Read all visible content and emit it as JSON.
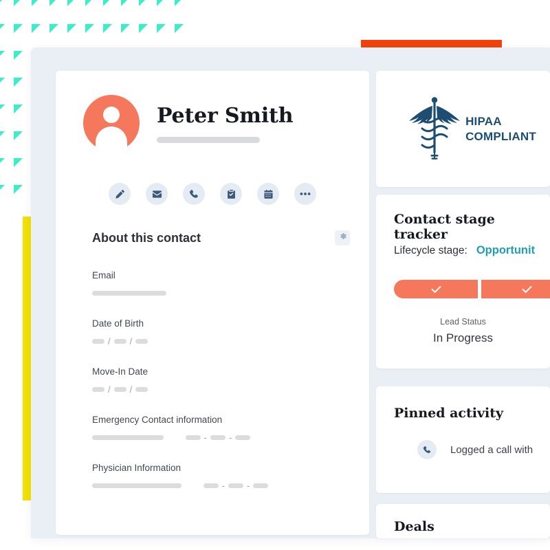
{
  "decor": {
    "triangle_color": "#3aefc8",
    "triangle_rows": 5,
    "triangle_cols": 11,
    "yellow_bar_color": "#f2e006",
    "orange_bar_color": "#f4400b",
    "panel_bg": "#eaeff5"
  },
  "contact": {
    "name": "Peter Smith",
    "avatar_color": "#f5785c",
    "avatar_icon": "person-icon",
    "name_redacted_bar": true,
    "actions": [
      {
        "name": "edit-contact-button",
        "icon": "pencil-square-icon"
      },
      {
        "name": "email-contact-button",
        "icon": "envelope-icon"
      },
      {
        "name": "call-contact-button",
        "icon": "phone-icon"
      },
      {
        "name": "task-contact-button",
        "icon": "clipboard-check-icon"
      },
      {
        "name": "schedule-meeting-button",
        "icon": "calendar-icon"
      },
      {
        "name": "more-actions-button",
        "icon": "ellipsis-icon"
      }
    ]
  },
  "about": {
    "title": "About this contact",
    "settings_icon": "gear-icon",
    "fields": [
      {
        "label": "Email",
        "type": "single",
        "widths": [
          108
        ]
      },
      {
        "label": "Date of Birth",
        "type": "date",
        "widths": [
          18,
          18,
          18
        ],
        "separator": "/"
      },
      {
        "label": "Move-In Date",
        "type": "date",
        "widths": [
          18,
          18,
          18
        ],
        "separator": "/"
      },
      {
        "label": "Emergency Contact information",
        "type": "name-phone",
        "widths": [
          104,
          22,
          22,
          22
        ],
        "separator": "-"
      },
      {
        "label": "Physician Information",
        "type": "name-phone",
        "widths": [
          130,
          22,
          22,
          22
        ],
        "separator": "-"
      }
    ]
  },
  "hipaa": {
    "line1": "HIPAA",
    "line2": "COMPLIANT",
    "icon": "caduceus-icon",
    "color": "#1d4d70"
  },
  "tracker": {
    "title": "Contact stage tracker",
    "lifecycle_label": "Lifecycle stage:",
    "lifecycle_value": "Opportunit",
    "lifecycle_value_color": "#1f9fb0",
    "stages": [
      {
        "name": "stage-segment-completed-1",
        "state": "complete",
        "icon": "check-icon",
        "width": 122
      },
      {
        "name": "stage-segment-completed-2",
        "state": "complete",
        "icon": "check-icon",
        "width": 133
      }
    ],
    "stage_color": "#f5785c",
    "lead_status_label": "Lead Status",
    "lead_status_value": "In Progress"
  },
  "pinned": {
    "title": "Pinned activity",
    "icon": "phone-icon",
    "text": "Logged a call with"
  },
  "deals": {
    "title": "Deals"
  }
}
